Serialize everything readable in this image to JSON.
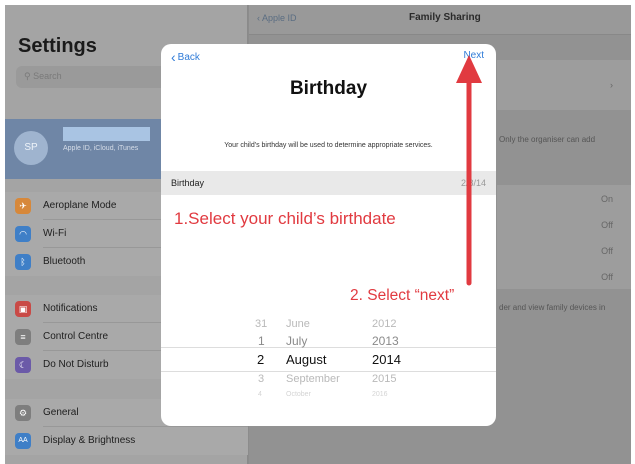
{
  "left_pane": {
    "title": "Settings",
    "search_placeholder": "Search",
    "profile": {
      "initials": "SP",
      "subtitle": "Apple ID, iCloud, iTunes"
    },
    "groups": [
      [
        {
          "label": "Aeroplane Mode",
          "icon": "airplane-icon",
          "color": "#d7883a",
          "glyph": "✈"
        },
        {
          "label": "Wi-Fi",
          "icon": "wifi-icon",
          "color": "#3f7fc7",
          "glyph": "◠"
        },
        {
          "label": "Bluetooth",
          "icon": "bluetooth-icon",
          "color": "#3f7fc7",
          "glyph": "ᛒ"
        }
      ],
      [
        {
          "label": "Notifications",
          "icon": "notifications-icon",
          "color": "#c94a46",
          "glyph": "▣"
        },
        {
          "label": "Control Centre",
          "icon": "control-centre-icon",
          "color": "#7e7e7e",
          "glyph": "≡"
        },
        {
          "label": "Do Not Disturb",
          "icon": "moon-icon",
          "color": "#6b5aa8",
          "glyph": "☾"
        }
      ],
      [
        {
          "label": "General",
          "icon": "gear-icon",
          "color": "#7e7e7e",
          "glyph": "⚙"
        },
        {
          "label": "Display & Brightness",
          "icon": "display-icon",
          "color": "#3f7fc7",
          "glyph": "AA"
        }
      ]
    ]
  },
  "right_pane": {
    "back_label": "Apple ID",
    "title": "Family Sharing",
    "organiser_note": "Only the organiser can add",
    "location_note": "der and view family devices in",
    "values": [
      "On",
      "Off",
      "Off",
      "Off"
    ]
  },
  "modal": {
    "back_label": "Back",
    "next_label": "Next",
    "title": "Birthday",
    "description": "Your child's birthday will be used to determine appropriate services.",
    "birthday_label": "Birthday",
    "birthday_value": "2/8/14"
  },
  "picker": {
    "days": [
      "31",
      "1",
      "2",
      "3",
      "4"
    ],
    "months": [
      "June",
      "July",
      "August",
      "September",
      "October"
    ],
    "years": [
      "2012",
      "2013",
      "2014",
      "2015",
      "2016"
    ],
    "selected": {
      "day": "2",
      "month": "August",
      "year": "2014"
    }
  },
  "annotations": {
    "step1": "1.Select your child’s birthdate",
    "step2": "2. Select “next”",
    "color": "#e13a40"
  }
}
